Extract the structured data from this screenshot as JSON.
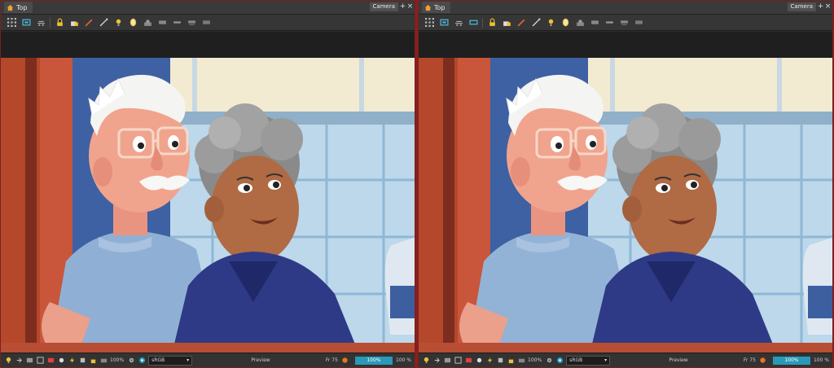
{
  "panels": [
    {
      "tab_label": "Top",
      "view_mode": "Camera",
      "plus_label": "+",
      "close_label": "×",
      "status": {
        "zoom_left": "100%",
        "color_space": "sRGB",
        "preview_label": "Preview",
        "frame": "Fr 75",
        "zoom_right": "100%",
        "zoom_extra": "100 %"
      }
    },
    {
      "tab_label": "Top",
      "view_mode": "Camera",
      "plus_label": "+",
      "close_label": "×",
      "status": {
        "zoom_left": "100%",
        "color_space": "sRGB",
        "preview_label": "Preview",
        "frame": "Fr 75",
        "zoom_right": "100%",
        "zoom_extra": "100 %"
      }
    }
  ],
  "toolbar_icons": [
    "grid-icon",
    "view-icon",
    "camera-icon",
    "layer-icon",
    "lock-icon",
    "stack-icon",
    "brush-icon",
    "pen-icon",
    "light-icon",
    "egg-icon",
    "scene-icon",
    "shape-icon",
    "move-icon",
    "rotate-icon",
    "scale-icon"
  ],
  "colors": {
    "accent": "#2a99b8",
    "frame_border": "#7a2020",
    "panel_bg": "#2c2c2c"
  }
}
